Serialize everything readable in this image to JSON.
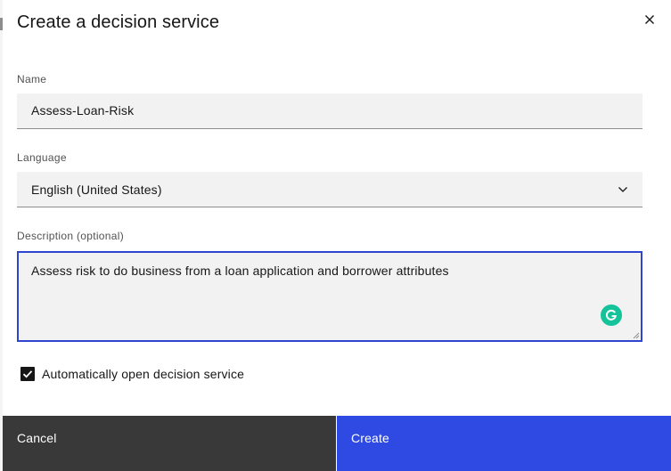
{
  "dialog": {
    "title": "Create a decision service",
    "close_icon": "close-icon"
  },
  "name": {
    "label": "Name",
    "value": "Assess-Loan-Risk"
  },
  "language": {
    "label": "Language",
    "selected": "English (United States)",
    "icon": "chevron-down-icon"
  },
  "description": {
    "label": "Description (optional)",
    "value": "Assess risk to do business from a loan application and borrower attributes",
    "focus_color": "#3045cf"
  },
  "auto_open": {
    "label": "Automatically open decision service",
    "checked": true
  },
  "buttons": {
    "cancel_label": "Cancel",
    "create_label": "Create",
    "cancel_color": "#393939",
    "create_color": "#2f4ae3"
  }
}
